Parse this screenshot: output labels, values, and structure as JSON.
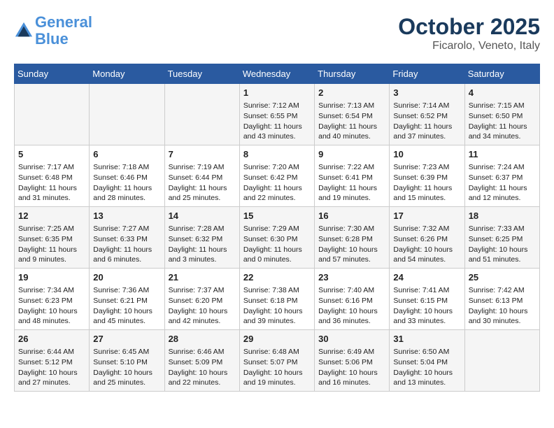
{
  "header": {
    "logo_line1": "General",
    "logo_line2": "Blue",
    "title": "October 2025",
    "subtitle": "Ficarolo, Veneto, Italy"
  },
  "days_of_week": [
    "Sunday",
    "Monday",
    "Tuesday",
    "Wednesday",
    "Thursday",
    "Friday",
    "Saturday"
  ],
  "weeks": [
    [
      {
        "day": "",
        "info": ""
      },
      {
        "day": "",
        "info": ""
      },
      {
        "day": "",
        "info": ""
      },
      {
        "day": "1",
        "info": "Sunrise: 7:12 AM\nSunset: 6:55 PM\nDaylight: 11 hours\nand 43 minutes."
      },
      {
        "day": "2",
        "info": "Sunrise: 7:13 AM\nSunset: 6:54 PM\nDaylight: 11 hours\nand 40 minutes."
      },
      {
        "day": "3",
        "info": "Sunrise: 7:14 AM\nSunset: 6:52 PM\nDaylight: 11 hours\nand 37 minutes."
      },
      {
        "day": "4",
        "info": "Sunrise: 7:15 AM\nSunset: 6:50 PM\nDaylight: 11 hours\nand 34 minutes."
      }
    ],
    [
      {
        "day": "5",
        "info": "Sunrise: 7:17 AM\nSunset: 6:48 PM\nDaylight: 11 hours\nand 31 minutes."
      },
      {
        "day": "6",
        "info": "Sunrise: 7:18 AM\nSunset: 6:46 PM\nDaylight: 11 hours\nand 28 minutes."
      },
      {
        "day": "7",
        "info": "Sunrise: 7:19 AM\nSunset: 6:44 PM\nDaylight: 11 hours\nand 25 minutes."
      },
      {
        "day": "8",
        "info": "Sunrise: 7:20 AM\nSunset: 6:42 PM\nDaylight: 11 hours\nand 22 minutes."
      },
      {
        "day": "9",
        "info": "Sunrise: 7:22 AM\nSunset: 6:41 PM\nDaylight: 11 hours\nand 19 minutes."
      },
      {
        "day": "10",
        "info": "Sunrise: 7:23 AM\nSunset: 6:39 PM\nDaylight: 11 hours\nand 15 minutes."
      },
      {
        "day": "11",
        "info": "Sunrise: 7:24 AM\nSunset: 6:37 PM\nDaylight: 11 hours\nand 12 minutes."
      }
    ],
    [
      {
        "day": "12",
        "info": "Sunrise: 7:25 AM\nSunset: 6:35 PM\nDaylight: 11 hours\nand 9 minutes."
      },
      {
        "day": "13",
        "info": "Sunrise: 7:27 AM\nSunset: 6:33 PM\nDaylight: 11 hours\nand 6 minutes."
      },
      {
        "day": "14",
        "info": "Sunrise: 7:28 AM\nSunset: 6:32 PM\nDaylight: 11 hours\nand 3 minutes."
      },
      {
        "day": "15",
        "info": "Sunrise: 7:29 AM\nSunset: 6:30 PM\nDaylight: 11 hours\nand 0 minutes."
      },
      {
        "day": "16",
        "info": "Sunrise: 7:30 AM\nSunset: 6:28 PM\nDaylight: 10 hours\nand 57 minutes."
      },
      {
        "day": "17",
        "info": "Sunrise: 7:32 AM\nSunset: 6:26 PM\nDaylight: 10 hours\nand 54 minutes."
      },
      {
        "day": "18",
        "info": "Sunrise: 7:33 AM\nSunset: 6:25 PM\nDaylight: 10 hours\nand 51 minutes."
      }
    ],
    [
      {
        "day": "19",
        "info": "Sunrise: 7:34 AM\nSunset: 6:23 PM\nDaylight: 10 hours\nand 48 minutes."
      },
      {
        "day": "20",
        "info": "Sunrise: 7:36 AM\nSunset: 6:21 PM\nDaylight: 10 hours\nand 45 minutes."
      },
      {
        "day": "21",
        "info": "Sunrise: 7:37 AM\nSunset: 6:20 PM\nDaylight: 10 hours\nand 42 minutes."
      },
      {
        "day": "22",
        "info": "Sunrise: 7:38 AM\nSunset: 6:18 PM\nDaylight: 10 hours\nand 39 minutes."
      },
      {
        "day": "23",
        "info": "Sunrise: 7:40 AM\nSunset: 6:16 PM\nDaylight: 10 hours\nand 36 minutes."
      },
      {
        "day": "24",
        "info": "Sunrise: 7:41 AM\nSunset: 6:15 PM\nDaylight: 10 hours\nand 33 minutes."
      },
      {
        "day": "25",
        "info": "Sunrise: 7:42 AM\nSunset: 6:13 PM\nDaylight: 10 hours\nand 30 minutes."
      }
    ],
    [
      {
        "day": "26",
        "info": "Sunrise: 6:44 AM\nSunset: 5:12 PM\nDaylight: 10 hours\nand 27 minutes."
      },
      {
        "day": "27",
        "info": "Sunrise: 6:45 AM\nSunset: 5:10 PM\nDaylight: 10 hours\nand 25 minutes."
      },
      {
        "day": "28",
        "info": "Sunrise: 6:46 AM\nSunset: 5:09 PM\nDaylight: 10 hours\nand 22 minutes."
      },
      {
        "day": "29",
        "info": "Sunrise: 6:48 AM\nSunset: 5:07 PM\nDaylight: 10 hours\nand 19 minutes."
      },
      {
        "day": "30",
        "info": "Sunrise: 6:49 AM\nSunset: 5:06 PM\nDaylight: 10 hours\nand 16 minutes."
      },
      {
        "day": "31",
        "info": "Sunrise: 6:50 AM\nSunset: 5:04 PM\nDaylight: 10 hours\nand 13 minutes."
      },
      {
        "day": "",
        "info": ""
      }
    ]
  ]
}
